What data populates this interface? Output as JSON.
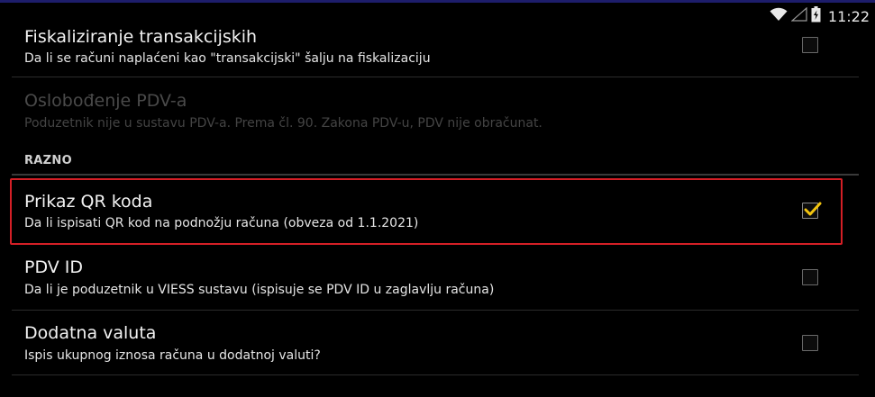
{
  "status_bar": {
    "time": "11:22",
    "icons": [
      "wifi-icon",
      "signal-icon",
      "battery-icon"
    ]
  },
  "settings": [
    {
      "title": "Fiskaliziranje transakcijskih",
      "summary": "Da li se računi naplaćeni kao \"transakcijski\" šalju na fiskalizaciju",
      "checked": false,
      "enabled": true
    },
    {
      "title": "Oslobođenje PDV-a",
      "summary": "Poduzetnik nije u sustavu PDV-a. Prema čl. 90. Zakona PDV-u, PDV nije obračunat.",
      "checked": false,
      "enabled": false
    }
  ],
  "section": {
    "header": "RAZNO",
    "items": [
      {
        "title": "Prikaz QR koda",
        "summary": "Da li ispisati QR kod na podnožju računa (obveza od 1.1.2021)",
        "checked": true,
        "enabled": true,
        "highlighted": true
      },
      {
        "title": "PDV ID",
        "summary": "Da li je poduzetnik u VIESS sustavu (ispisuje se PDV ID u zaglavlju računa)",
        "checked": false,
        "enabled": true
      },
      {
        "title": "Dodatna valuta",
        "summary": "Ispis ukupnog iznosa računa u dodatnoj valuti?",
        "checked": false,
        "enabled": true
      }
    ]
  },
  "colors": {
    "background": "#000000",
    "highlight_border": "#d41f26",
    "checkmark": "#f2c40f",
    "status_bar_accent": "#1d1d6b"
  }
}
